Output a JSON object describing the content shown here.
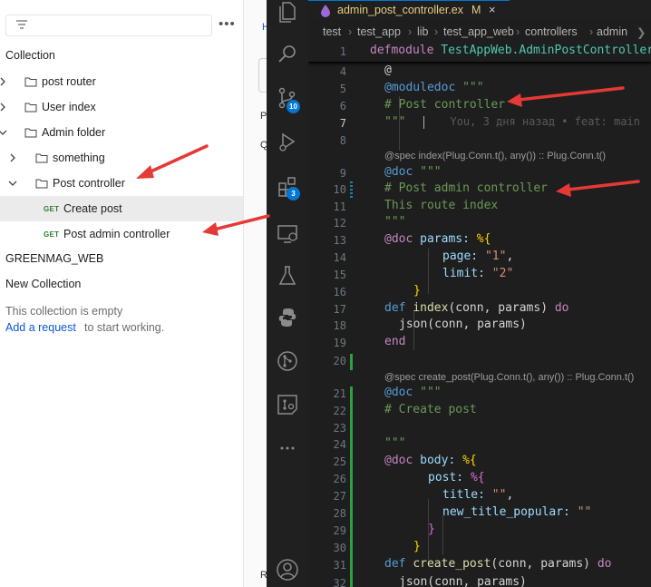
{
  "sidebar": {
    "collection_label": "Collection",
    "tree": [
      {
        "label": "post router",
        "kind": "folder",
        "expanded": false
      },
      {
        "label": "User index",
        "kind": "folder",
        "expanded": false
      },
      {
        "label": "Admin folder",
        "kind": "folder",
        "expanded": true
      },
      {
        "label": "something",
        "kind": "folder",
        "expanded": false
      },
      {
        "label": "Post controller",
        "kind": "folder",
        "expanded": true,
        "selected": true
      },
      {
        "method": "GET",
        "label": "Create post",
        "kind": "request"
      },
      {
        "method": "GET",
        "label": "Post admin controller",
        "kind": "request"
      }
    ],
    "other_collections": [
      "GREENMAG_WEB",
      "New Collection"
    ],
    "empty_message": "This collection is empty",
    "add_request_link": "Add a request",
    "add_request_suffix": "to start working."
  },
  "middle": {
    "frag_top": "H",
    "frag_p": "P",
    "frag_q": "Q",
    "frag_r": "R"
  },
  "editor": {
    "tab": {
      "filename": "admin_post_controller.ex",
      "status": "M",
      "close": "×"
    },
    "breadcrumb": [
      "test",
      "test_app",
      "lib",
      "test_app_web",
      "controllers",
      "admin",
      "❯"
    ],
    "blame": "You, 3 дня назад • feat: main",
    "lens": {
      "index": "@spec index(Plug.Conn.t(), any()) :: Plug.Conn.t()",
      "create": "@spec create_post(Plug.Conn.t(), any()) :: Plug.Conn.t()"
    },
    "line_numbers": [
      "1",
      "4",
      "5",
      "6",
      "7",
      "8",
      "9",
      "10",
      "11",
      "12",
      "13",
      "14",
      "15",
      "16",
      "17",
      "18",
      "19",
      "20",
      "21",
      "22",
      "23",
      "24",
      "25",
      "26",
      "27",
      "28",
      "29",
      "30",
      "31",
      "32"
    ],
    "active_line": "7",
    "code": {
      "l1_kw": "defmodule",
      "l1_mod": "TestAppWeb.AdminPostController",
      "l4": "@",
      "l5_attr": "@moduledoc",
      "l5_str": "\"\"\"",
      "l6": "# Post controller",
      "l7": "\"\"\"",
      "l9_attr": "@doc",
      "l9_str": "\"\"\"",
      "l10": "# Post admin controller",
      "l11": "This route index",
      "l12": "\"\"\"",
      "l13_attr": "@doc",
      "l13_key": "params:",
      "l13_brace": "%{",
      "l14_key": "page:",
      "l14_val": "\"1\"",
      "l15_key": "limit:",
      "l15_val": "\"2\"",
      "l16": "}",
      "l17_def": "def",
      "l17_fn": "index",
      "l17_args": "(conn, params)",
      "l17_do": "do",
      "l18": "json(conn, params)",
      "l19": "end",
      "l21_attr": "@doc",
      "l21_str": "\"\"\"",
      "l22": "# Create post",
      "l24": "\"\"\"",
      "l25_attr": "@doc",
      "l25_key": "body:",
      "l25_brace": "%{",
      "l26_key": "post:",
      "l26_brace": "%{",
      "l27_key": "title:",
      "l27_val": "\"\"",
      "l28_key": "new_title_popular:",
      "l28_val": "\"\"",
      "l29": "}",
      "l30": "}",
      "l31_def": "def",
      "l31_fn": "create_post",
      "l31_args": "(conn, params)",
      "l31_do": "do",
      "l32": "json(conn, params)"
    }
  },
  "activity_bar": {
    "icons": [
      "files-icon",
      "search-icon",
      "source-control-icon",
      "run-debug-icon",
      "extensions-icon",
      "remote-explorer-icon",
      "testing-icon",
      "python-icon",
      "git-graph-icon",
      "gitlens-icon",
      "more-icon",
      "account-icon"
    ],
    "source_control_badge": "10",
    "extensions_badge": "3"
  },
  "colors": {
    "annotation_arrow": "#e53935",
    "vscode_accent": "#0078d4",
    "get_method": "#2e7d32"
  }
}
